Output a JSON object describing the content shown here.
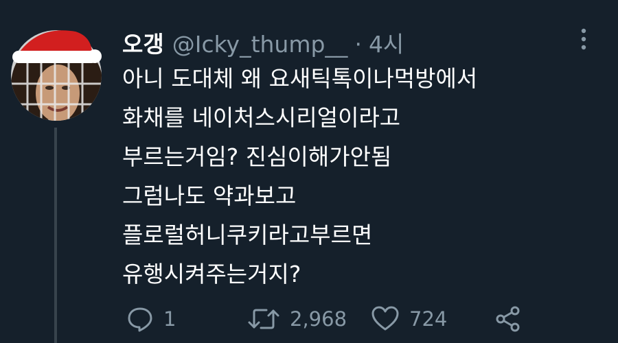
{
  "tweet": {
    "display_name": "오갱",
    "handle": "@Icky_thump__",
    "separator": "·",
    "time": "4시",
    "lines": [
      "아니 도대체 왜 요새틱톡이나먹방에서",
      "화채를 네이처스시리얼이라고",
      "부르는거임? 진심이해가안됨",
      "그럼나도 약과보고",
      "플로럴허니쿠키라고부르면",
      "유행시켜주는거지?"
    ]
  },
  "actions": {
    "reply_count": "1",
    "retweet_count": "2,968",
    "like_count": "724"
  },
  "icons": {
    "reply": "speech-bubble-icon",
    "retweet": "retweet-arrows-icon",
    "like": "heart-icon",
    "share": "share-icon",
    "more": "vertical-dots-icon"
  },
  "colors": {
    "background": "#15202b",
    "primary_text": "#ffffff",
    "secondary_text": "#8899a6",
    "thread_line": "#38444d"
  }
}
